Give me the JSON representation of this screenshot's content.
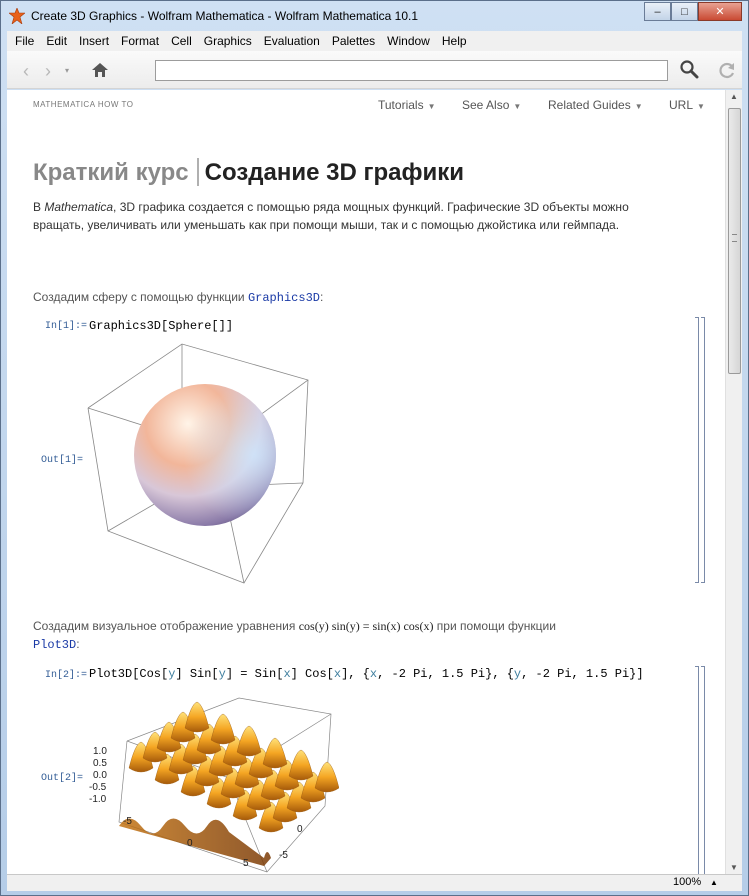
{
  "window": {
    "title": "Create 3D Graphics - Wolfram Mathematica - Wolfram Mathematica 10.1",
    "buttons": {
      "minimize": "–",
      "maximize": "□",
      "close": "✕"
    }
  },
  "menubar": {
    "items": [
      "File",
      "Edit",
      "Insert",
      "Format",
      "Cell",
      "Graphics",
      "Evaluation",
      "Palettes",
      "Window",
      "Help"
    ]
  },
  "toolbar": {
    "back": "‹",
    "forward": "›",
    "dropdown": "▾",
    "url_value": ""
  },
  "doc": {
    "howto_label": "MATHEMATICA HOW TO",
    "dock_menus": [
      {
        "label": "Tutorials",
        "caret": "▼"
      },
      {
        "label": "See Also",
        "caret": "▼"
      },
      {
        "label": "Related Guides",
        "caret": "▼"
      },
      {
        "label": "URL",
        "caret": "▼"
      }
    ],
    "title_part1": "Краткий курс",
    "title_part2": "Создание 3D графики",
    "intro_prefix": "В ",
    "intro_italic": "Mathematica",
    "intro_rest": ", 3D графика создается с помощью ряда мощных функций.  Графические 3D объекты можно вращать, увеличивать или уменьшать как при помощи мыши, так и с помощью джойстика или геймпада.",
    "para1_text": "Создадим сферу с помощью функции ",
    "para1_code": "Graphics3D",
    "para1_end": ":",
    "in1_label": "In[1]:=",
    "in1_code": "Graphics3D[Sphere[]]",
    "out1_label": "Out[1]=",
    "para2_text": "Создадим визуальное отображение уравнения ",
    "para2_math": "cos(y) sin(y) = sin(x) cos(x)",
    "para2_after": " при помощи функции",
    "para2_code": "Plot3D",
    "para2_end": ":",
    "in2_label": "In[2]:=",
    "in2_code_parts": [
      "Plot3D[Cos[",
      "y",
      "] Sin[",
      "y",
      "] = Sin[",
      "x",
      "] Cos[",
      "x",
      "], {",
      "x",
      ", -2 Pi, 1.5 Pi}, {",
      "y",
      ", -2 Pi, 1.5 Pi}]"
    ],
    "out2_label": "Out[2]=",
    "plot_ticks_z": [
      "1.0",
      "0.5",
      "0.0",
      "-0.5",
      "-1.0"
    ],
    "plot_ticks_x": [
      "-5",
      "0",
      "5"
    ],
    "plot_ticks_y": [
      "0",
      "-5"
    ]
  },
  "statusbar": {
    "zoom": "100%",
    "zoom_caret": "▲"
  }
}
